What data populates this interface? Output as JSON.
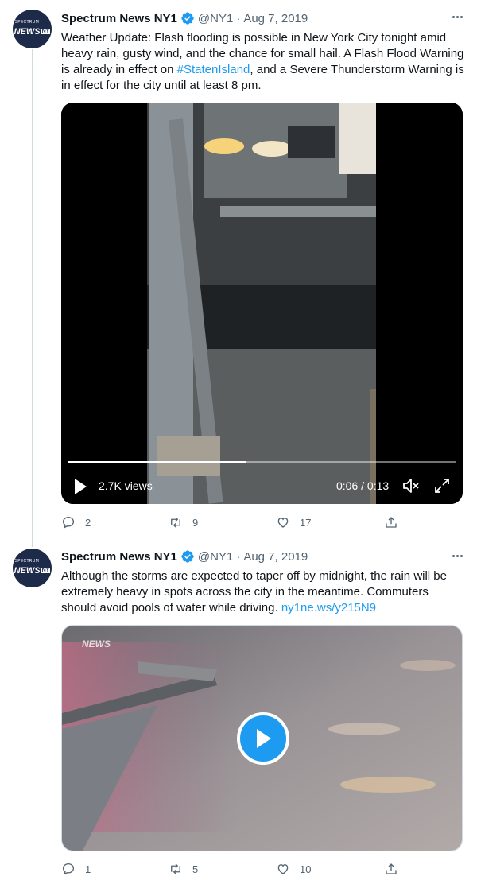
{
  "tweets": [
    {
      "author_name": "Spectrum News NY1",
      "handle": "@NY1",
      "separator": "·",
      "date": "Aug 7, 2019",
      "avatar": {
        "top_text": "SPECTRUM",
        "main_text": "NEWS",
        "badge_text": "NY"
      },
      "text_parts": {
        "before_link": "Weather Update: Flash flooding is possible in New York City tonight amid heavy rain, gusty wind, and the chance for small hail. A Flash Flood Warning is already in effect on ",
        "hashtag": "#StatenIsland",
        "after_link": ", and a Severe Thunderstorm Warning is in effect for the city until at least 8 pm."
      },
      "video": {
        "views": "2.7K views",
        "time": "0:06 / 0:13",
        "progress": 0.46
      },
      "replies": "2",
      "retweets": "9",
      "likes": "17"
    },
    {
      "author_name": "Spectrum News NY1",
      "handle": "@NY1",
      "separator": "·",
      "date": "Aug 7, 2019",
      "avatar": {
        "top_text": "SPECTRUM",
        "main_text": "NEWS",
        "badge_text": "NY"
      },
      "text_parts": {
        "before_link": "Although the storms are expected to taper off by midnight, the rain will be extremely heavy in spots across the city in the meantime. Commuters should avoid pools of water while driving. ",
        "url": "ny1ne.ws/y215N9"
      },
      "video": {
        "watermark": "NEWS"
      },
      "replies": "1",
      "retweets": "5",
      "likes": "10"
    }
  ],
  "colors": {
    "accent": "#1d9bf0",
    "muted": "#536471",
    "text": "#0f1419",
    "thread_line": "#cfd9de"
  },
  "icons": [
    "verified-badge-icon",
    "more-icon",
    "play-icon",
    "mute-icon",
    "fullscreen-icon",
    "reply-icon",
    "retweet-icon",
    "like-icon",
    "share-icon",
    "play-circle-icon"
  ]
}
